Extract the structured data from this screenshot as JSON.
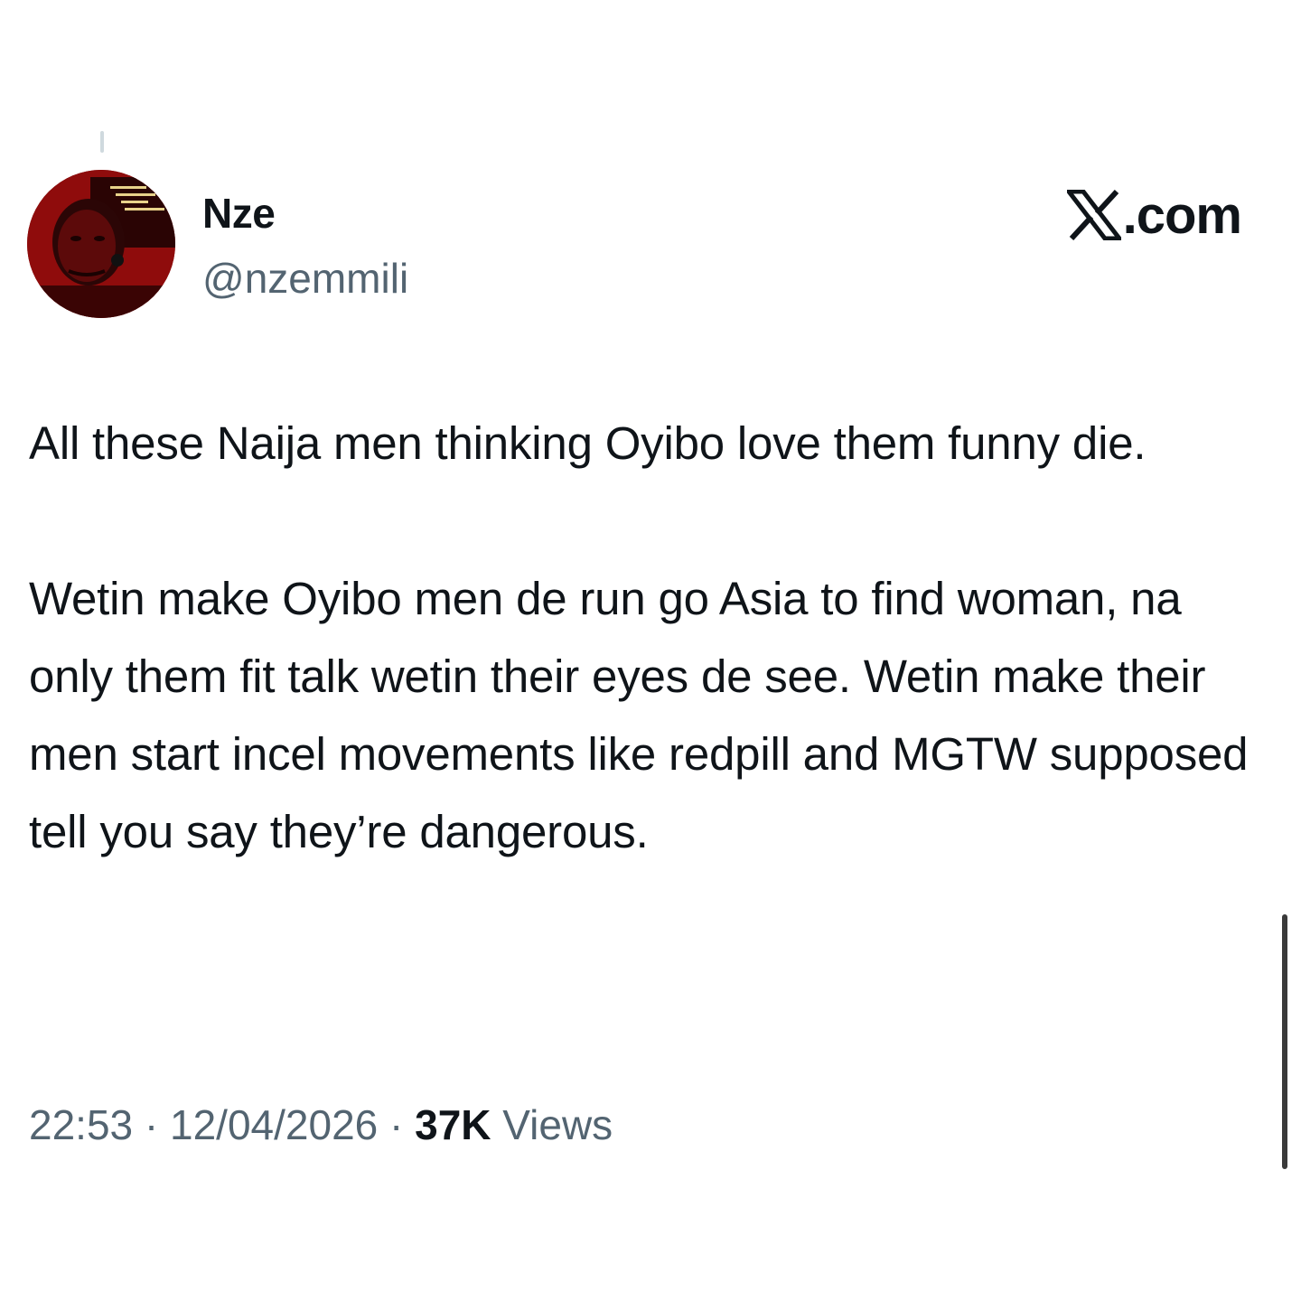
{
  "author": {
    "display_name": "Nze",
    "handle": "@nzemmili"
  },
  "brand": {
    "icon": "x-logo-icon",
    "label": ".com"
  },
  "tweet": {
    "text": "All these Naija men thinking Oyibo love them funny die.\n\nWetin make Oyibo men de run go Asia to find woman, na only them fit talk wetin their eyes de see. Wetin make their men start incel movements like redpill and MGTW supposed tell you say they’re dangerous."
  },
  "meta": {
    "time": "22:53",
    "separator": " · ",
    "date": "12/04/2026",
    "views_count": "37K",
    "views_label": " Views"
  },
  "colors": {
    "text": "#0f1419",
    "secondary": "#536471",
    "avatar_red": "#c01515"
  }
}
